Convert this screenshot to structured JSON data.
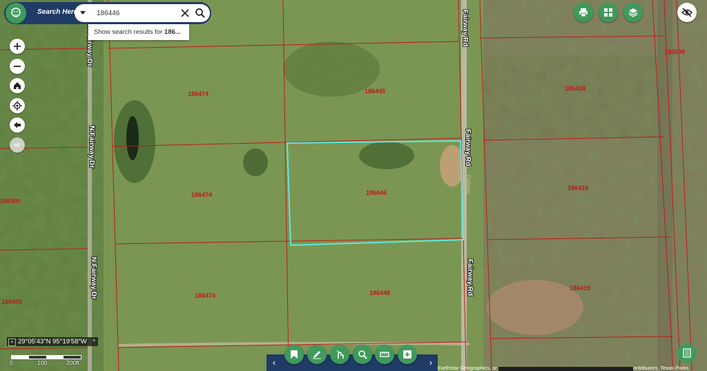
{
  "search": {
    "title": "Search Here:",
    "value": "186446",
    "suggestion_prefix": "Show search results for ",
    "suggestion_term": "186..."
  },
  "roads": {
    "fairway_rd": "Fairway Rd",
    "n_fairway_dr": "N Fairway Dr",
    "fairway_faint": "Fairway"
  },
  "parcels": {
    "p_top_left": "186474",
    "p_top_mid": "186445",
    "p_mid_left": "186474",
    "p_selected": "186446",
    "p_bot_left": "186474",
    "p_bot_mid": "186448",
    "p_right_top": "186418",
    "p_right_mid": "186418",
    "p_right_bot": "186419",
    "p_far_right": "186500",
    "p_left_edge1": "186900",
    "p_left_edge2": "186505"
  },
  "coordinates": "29°05′43″N 95°19′58″W",
  "scale": {
    "l0": "0",
    "l1": "100",
    "l2": "200ft"
  },
  "attribution": "Earthstar Geographics, ar",
  "attribution_end": "ontributors, Texas Parks",
  "icons": {
    "logo": "face-logo-icon",
    "dropdown": "chevron-down-icon",
    "clear": "close-icon",
    "search": "search-icon",
    "print": "print-icon",
    "grid": "grid-icon",
    "layers": "layers-icon",
    "visibility": "eye-off-icon",
    "list": "list-icon"
  },
  "colors": {
    "bar": "#1f3b66",
    "button": "#3f9a5c",
    "parcel_line": "#c41818",
    "selection": "#5fe8e0"
  }
}
